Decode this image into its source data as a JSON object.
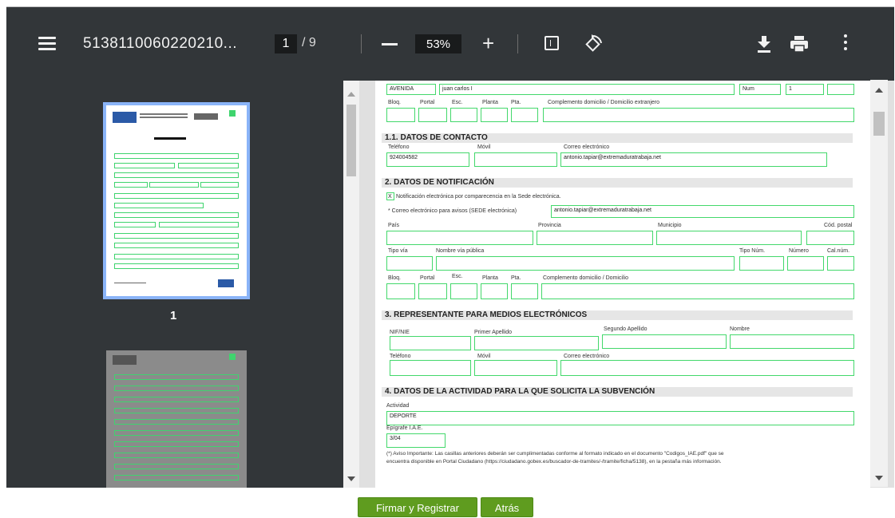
{
  "toolbar": {
    "title": "5138110060220210...",
    "page_current": "1",
    "page_total": "/ 9",
    "zoom": "53%",
    "icons": [
      "menu-icon",
      "zoom-out-icon",
      "zoom-in-icon",
      "fit-page-icon",
      "rotate-icon",
      "download-icon",
      "print-icon",
      "more-options-icon"
    ]
  },
  "sidebar": {
    "thumb_label": "1"
  },
  "form": {
    "s_address": {
      "labels": [
        "Bloq.",
        "Portal",
        "Esc.",
        "Planta",
        "Pta.",
        "Complemento domicilio / Domicilio extranjero"
      ],
      "tipo_via": "AVENIDA",
      "nombre_via": "juan carlos I",
      "tipo_num": "Num",
      "numero": "1"
    },
    "s11": {
      "title": "1.1. DATOS DE CONTACTO",
      "labels": [
        "Teléfono",
        "Móvil",
        "Correo electrónico"
      ],
      "telefono": "924004582",
      "correo": "antonio.tapiar@extremaduratrabaja.net"
    },
    "s2": {
      "title": "2. DATOS DE NOTIFICACIÓN",
      "checkbox_mark": "X",
      "checkbox_label": "Notificación electrónica por comparecencia en la Sede electrónica.",
      "aviso_label": "*  Correo electrónico para avisos (SEDE electrónica)",
      "aviso_value": "antonio.tapiar@extremaduratrabaja.net",
      "labels_row1": [
        "País",
        "Provincia",
        "Municipio",
        "Cód. postal"
      ],
      "labels_row2": [
        "Tipo vía",
        "Nombre vía pública",
        "Tipo Núm.",
        "Número",
        "Cal.núm."
      ],
      "labels_row3": [
        "Bloq.",
        "Portal",
        "Esc.",
        "Planta",
        "Pta.",
        "Complemento domicilio / Domicilio"
      ]
    },
    "s3": {
      "title": "3. REPRESENTANTE PARA MEDIOS ELECTRÓNICOS",
      "labels_row1": [
        "NIF/NIE",
        "Primer Apellido",
        "Segundo Apellido",
        "Nombre"
      ],
      "labels_row2": [
        "Teléfono",
        "Móvil",
        "Correo electrónico"
      ]
    },
    "s4": {
      "title": "4. DATOS DE LA ACTIVIDAD PARA LA QUE SOLICITA LA SUBVENCIÓN",
      "actividad_label": "Actividad",
      "actividad": "DEPORTE",
      "epigrafe_label": "Epígrafe I.A.E.",
      "epigrafe": "3/04",
      "note1": "(*) Aviso Importante: Las casillas anteriores deberán ser cumplimentadas conforme al formato indicado en el documento \"Codigos_IAE.pdf\" que se",
      "note2": "encuentra disponible en Portal Ciudadano (https://ciudadano.gobex.es/buscador-de-tramites/-/tramite/ficha/5138), en la pestaña más información."
    }
  },
  "buttons": {
    "sign": "Firmar y Registrar",
    "back": "Atrás"
  },
  "colors": {
    "accent_button": "#5f9c1f",
    "field_border": "#43d86b",
    "toolbar": "#323639"
  }
}
